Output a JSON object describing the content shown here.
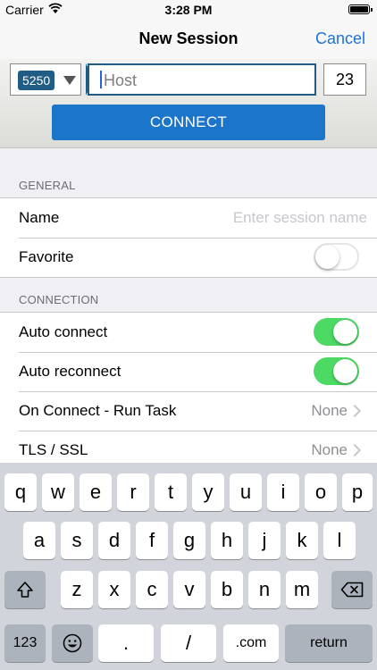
{
  "status_bar": {
    "carrier": "Carrier",
    "time": "3:28 PM"
  },
  "nav": {
    "title": "New Session",
    "cancel": "Cancel"
  },
  "connect_panel": {
    "terminal_type": "5250",
    "host_placeholder": "Host",
    "port_value": "23",
    "connect_label": "CONNECT"
  },
  "general": {
    "header": "GENERAL",
    "name_label": "Name",
    "name_placeholder": "Enter session name",
    "favorite_label": "Favorite",
    "favorite_on": false
  },
  "connection": {
    "header": "CONNECTION",
    "auto_connect_label": "Auto connect",
    "auto_connect_on": true,
    "auto_reconnect_label": "Auto reconnect",
    "auto_reconnect_on": true,
    "on_connect_label": "On Connect - Run Task",
    "on_connect_value": "None",
    "tls_label": "TLS / SSL",
    "tls_value": "None"
  },
  "keyboard": {
    "row1": [
      "q",
      "w",
      "e",
      "r",
      "t",
      "y",
      "u",
      "i",
      "o",
      "p"
    ],
    "row2": [
      "a",
      "s",
      "d",
      "f",
      "g",
      "h",
      "j",
      "k",
      "l"
    ],
    "row3": [
      "z",
      "x",
      "c",
      "v",
      "b",
      "n",
      "m"
    ],
    "numbers_label": "123",
    "period_label": ".",
    "slash_label": "/",
    "dotcom_label": ".com",
    "return_label": "return"
  },
  "colors": {
    "accent_blue": "#1e73d8",
    "connect_button": "#1b75c8",
    "badge": "#1f5d86",
    "switch_on": "#4cd964"
  }
}
